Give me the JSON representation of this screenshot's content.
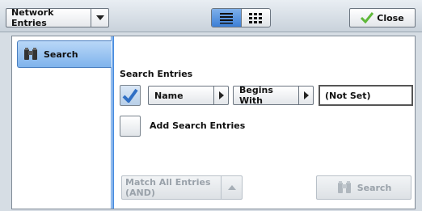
{
  "header": {
    "dropdown_label": "Network Entries",
    "close_label": "Close",
    "view_modes": [
      "list-view",
      "grid-view"
    ],
    "active_view": "list-view"
  },
  "sidebar": {
    "items": [
      {
        "label": "Search",
        "icon": "binoculars-icon",
        "selected": true
      }
    ]
  },
  "search": {
    "section_title": "Search Entries",
    "criteria": {
      "enabled": true,
      "field": "Name",
      "operator": "Begins With",
      "value": "(Not Set)"
    },
    "add_entries_label": "Add Search Entries",
    "add_entries_checked": false,
    "match_label": "Match All Entries (AND)",
    "match_enabled": false,
    "search_button_label": "Search",
    "search_button_enabled": false
  },
  "colors": {
    "accent": "#4a8ee0",
    "selected_tab": "#7fb3ec",
    "check_green": "#5fb83a",
    "disabled_text": "#9aa2aa"
  }
}
